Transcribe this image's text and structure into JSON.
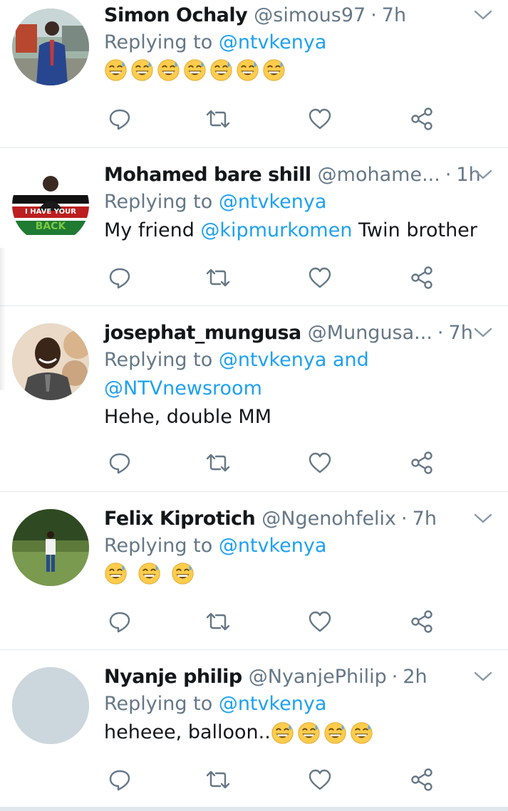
{
  "tweets": [
    {
      "name": "Simon Ochaly",
      "handle": "@simous97",
      "time": "7h",
      "replying_prefix": "Replying to",
      "replying_to": [
        "@ntvkenya"
      ],
      "replying_joiner": "",
      "text_before": "",
      "text_mention": "",
      "text_after": "",
      "emoji_count": 7,
      "avatar": "man-in-blue-suit-photo"
    },
    {
      "name": "Mohamed bare shill",
      "handle": "@mohame...",
      "time": "1h",
      "replying_prefix": "Replying to",
      "replying_to": [
        "@ntvkenya"
      ],
      "replying_joiner": "",
      "text_before": "My friend ",
      "text_mention": "@kipmurkomen",
      "text_after": " Twin brother",
      "emoji_count": 0,
      "avatar": "i-have-your-back-flag-badge",
      "avatar_text": "I HAVE YOUR BACK"
    },
    {
      "name": "josephat_mungusa",
      "handle": "@Mungusa...",
      "time": "7h",
      "replying_prefix": "Replying to",
      "replying_to": [
        "@ntvkenya",
        "@NTVnewsroom"
      ],
      "replying_joiner": "and",
      "text_before": "Hehe, double MM",
      "text_mention": "",
      "text_after": "",
      "emoji_count": 0,
      "avatar": "smiling-man-portrait"
    },
    {
      "name": "Felix Kiprotich",
      "handle": "@Ngenohfelix",
      "time": "7h",
      "replying_prefix": "Replying to",
      "replying_to": [
        "@ntvkenya"
      ],
      "replying_joiner": "",
      "text_before": "",
      "text_mention": "",
      "text_after": "",
      "emoji_count": 3,
      "avatar": "man-standing-on-lawn-photo"
    },
    {
      "name": "Nyanje philip",
      "handle": "@NyanjePhilip",
      "time": "2h",
      "replying_prefix": "Replying to",
      "replying_to": [
        "@ntvkenya"
      ],
      "replying_joiner": "",
      "text_before": "heheee, balloon..",
      "text_mention": "",
      "text_after": "",
      "emoji_count": 4,
      "avatar": "default-grey-avatar"
    }
  ],
  "separator": "·",
  "icons": {
    "menu": "chevron-down-icon",
    "reply": "reply-icon",
    "retweet": "retweet-icon",
    "like": "heart-icon",
    "share": "share-icon",
    "emoji": "grinning-sweat-emoji"
  },
  "colors": {
    "text": "#14171a",
    "secondary": "#657786",
    "link": "#1da1f2",
    "icon": "#657786",
    "divider": "#e1e8ed",
    "emoji_face": "#ffcc4d"
  }
}
